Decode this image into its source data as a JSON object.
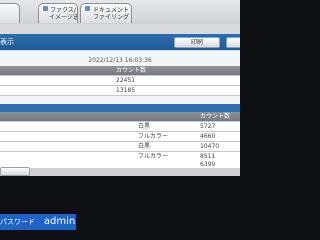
{
  "tabs": {
    "fax_image_send": "ファクス/\nイメージ送信",
    "document_filing": "ドキュメント\nファイリング"
  },
  "header": {
    "title": "表示",
    "print_button": "印刷"
  },
  "timestamp": "2022/12/13 16:03:36",
  "table1": {
    "header": "カウント数",
    "rows": [
      "22451",
      "13185"
    ]
  },
  "table2": {
    "header": "カウント数",
    "rows": [
      {
        "type": "白黒",
        "value": "5727"
      },
      {
        "type": "フルカラー",
        "value": "4660"
      },
      {
        "type": "白黒",
        "value": "10470"
      },
      {
        "type": "フルカラー",
        "value": "8511"
      },
      {
        "type": "",
        "value": "6390"
      }
    ]
  },
  "login": {
    "label": "パスワード",
    "user": "admin"
  }
}
